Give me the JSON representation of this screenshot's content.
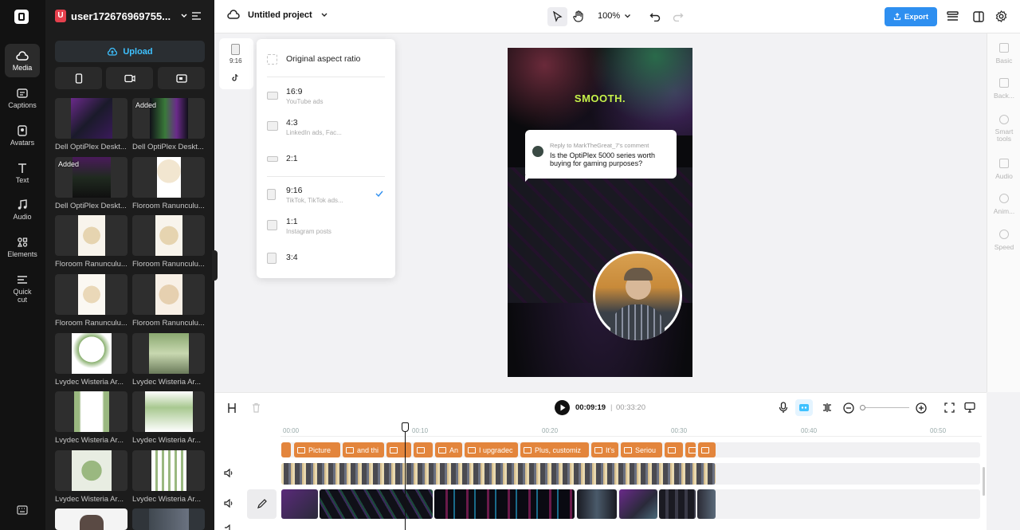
{
  "nav": {
    "items": [
      {
        "label": "Media"
      },
      {
        "label": "Captions"
      },
      {
        "label": "Avatars"
      },
      {
        "label": "Text"
      },
      {
        "label": "Audio"
      },
      {
        "label": "Elements"
      },
      {
        "label": "Quick cut"
      }
    ]
  },
  "panel": {
    "username": "user172676969755...",
    "avatar_letter": "U",
    "upload_label": "Upload",
    "media": [
      {
        "name": "Dell OptiPlex Deskt...",
        "added": ""
      },
      {
        "name": "Dell OptiPlex Deskt...",
        "added": "Added"
      },
      {
        "name": "Dell OptiPlex Deskt...",
        "added": "Added"
      },
      {
        "name": "Floroom Ranunculu...",
        "added": ""
      },
      {
        "name": "Floroom Ranunculu...",
        "added": ""
      },
      {
        "name": "Floroom Ranunculu...",
        "added": ""
      },
      {
        "name": "Floroom Ranunculu...",
        "added": ""
      },
      {
        "name": "Floroom Ranunculu...",
        "added": ""
      },
      {
        "name": "Lvydec Wisteria Ar...",
        "added": ""
      },
      {
        "name": "Lvydec Wisteria Ar...",
        "added": ""
      },
      {
        "name": "Lvydec Wisteria Ar...",
        "added": ""
      },
      {
        "name": "Lvydec Wisteria Ar...",
        "added": ""
      },
      {
        "name": "Lvydec Wisteria Ar...",
        "added": ""
      },
      {
        "name": "Lvydec Wisteria Ar...",
        "added": ""
      }
    ]
  },
  "topbar": {
    "project": "Untitled project",
    "zoom": "100%",
    "export_label": "Export"
  },
  "canvas": {
    "small_ratio": "9:16",
    "ratios": [
      {
        "label": "Original aspect ratio",
        "sub": ""
      },
      {
        "label": "16:9",
        "sub": "YouTube ads"
      },
      {
        "label": "4:3",
        "sub": "LinkedIn ads, Fac..."
      },
      {
        "label": "2:1",
        "sub": ""
      },
      {
        "label": "9:16",
        "sub": "TikTok, TikTok ads..."
      },
      {
        "label": "1:1",
        "sub": "Instagram posts"
      },
      {
        "label": "3:4",
        "sub": ""
      }
    ],
    "video_headline": "SMOOTH.",
    "comment_reply": "Reply to MarkTheGreat_7's comment",
    "comment_text": "Is the OptiPlex 5000 series worth buying for gaming purposes?"
  },
  "right_sidebar": [
    {
      "label": "Basic"
    },
    {
      "label": "Back..."
    },
    {
      "label": "Smart tools"
    },
    {
      "label": "Audio"
    },
    {
      "label": "Anim..."
    },
    {
      "label": "Speed"
    }
  ],
  "player": {
    "current": "00:09:19",
    "separator": "|",
    "total": "00:33:20"
  },
  "timeline": {
    "ruler": [
      "00:00",
      "00:10",
      "00:20",
      "00:30",
      "00:40",
      "00:50"
    ],
    "captions": [
      "",
      "Picture",
      "and thi",
      "",
      "",
      "An",
      "I upgradec",
      "Plus, customiz",
      "It's",
      "Seriou",
      "",
      "",
      ""
    ]
  },
  "colors": {
    "accent": "#2e8ff0",
    "caption": "#e3853c",
    "upload_text": "#3ec1ff",
    "rail_bg": "#121212"
  }
}
